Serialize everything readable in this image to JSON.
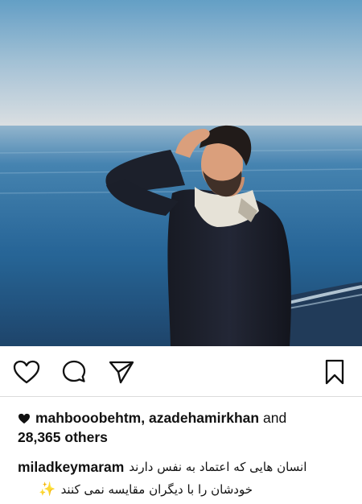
{
  "post": {
    "image_alt": "Man in dark sweater and scarf standing by the sea, hand on his head",
    "actions": {
      "like": "heart-icon",
      "comment": "comment-icon",
      "share": "send-icon",
      "save": "bookmark-icon"
    },
    "likes": {
      "users": "mahbooobehtm, azadehamirkhan",
      "and_word": "and",
      "others_count": "28,365 others"
    },
    "caption": {
      "username": "miladkeymaram",
      "line1": "انسان هایی که اعتماد به نفس دارند",
      "line2": "خودشان را با دیگران مقایسه نمی کنند",
      "emoji": "✨"
    }
  },
  "colors": {
    "sky_top": "#5f9cc4",
    "sky_bottom": "#d9dde0",
    "sea": "#1f5f92",
    "text": "#111111",
    "divider": "#dbdbdb"
  }
}
